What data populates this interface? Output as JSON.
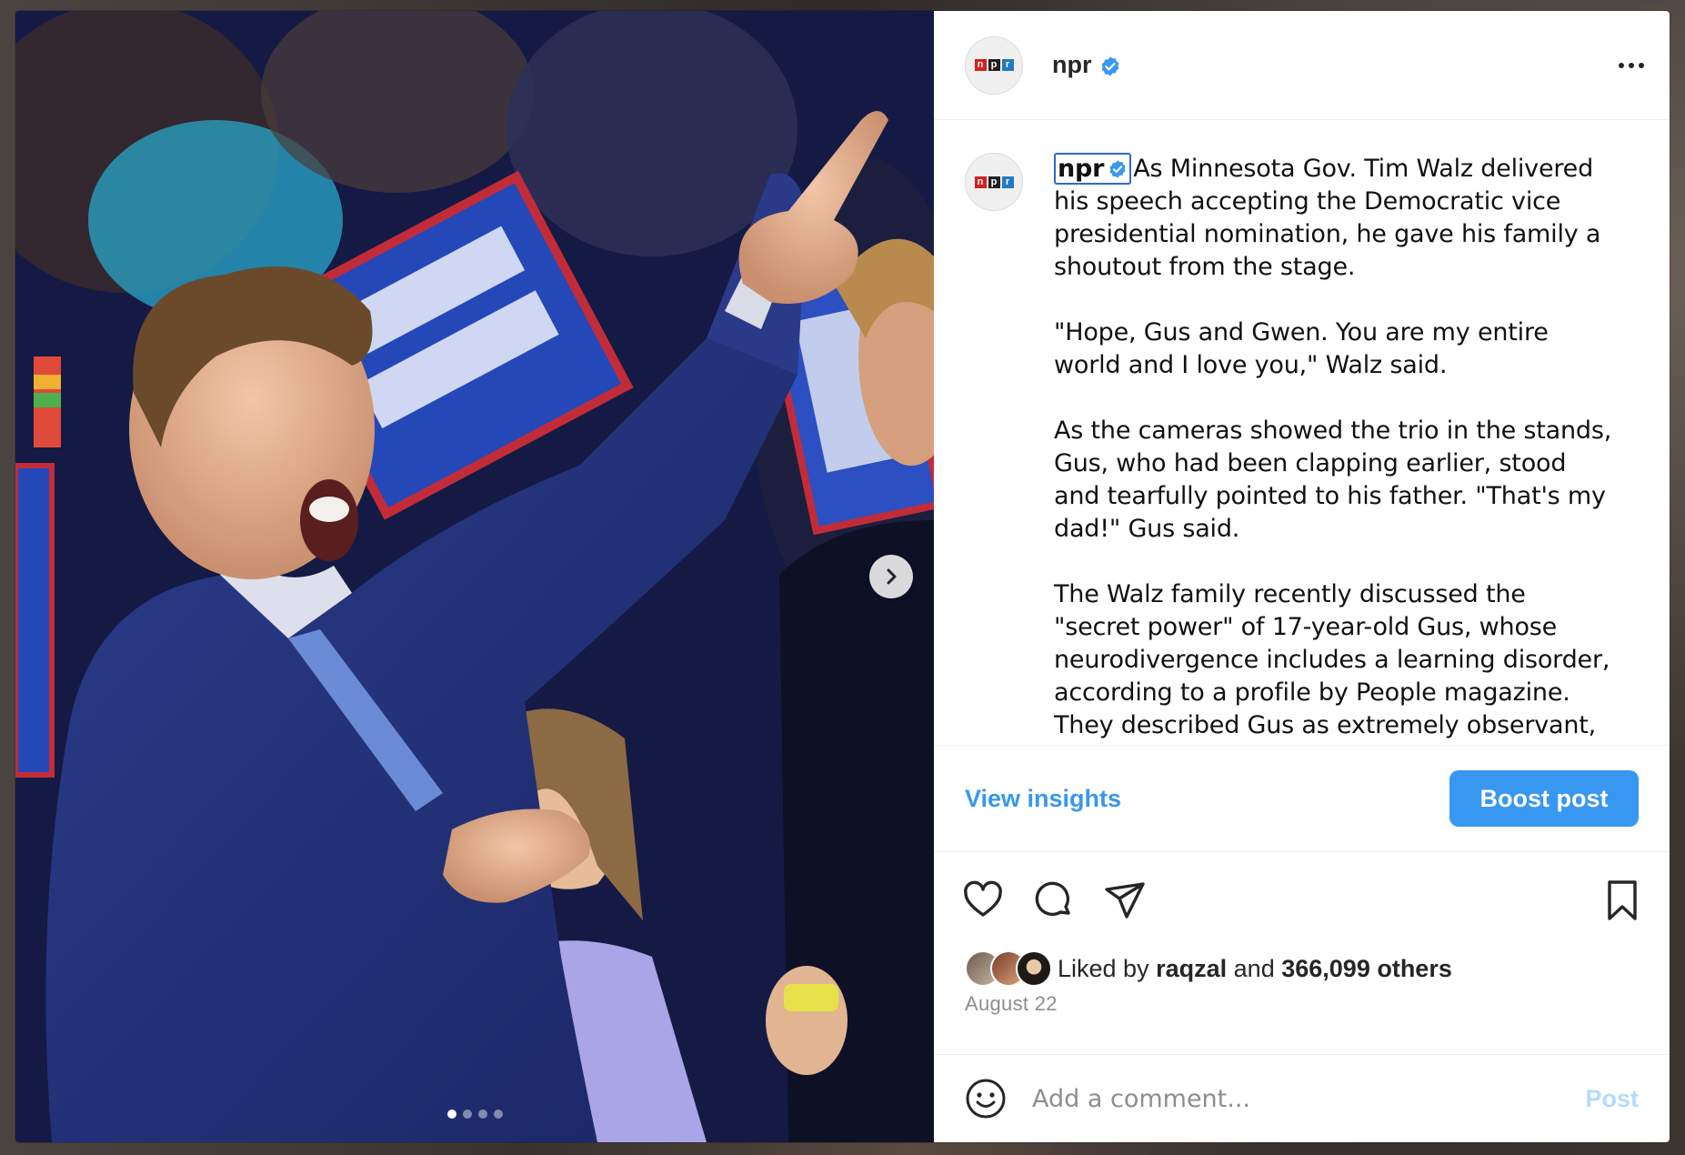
{
  "post": {
    "account": {
      "username": "npr",
      "verified": true,
      "avatar_logo": [
        "n",
        "p",
        "r"
      ]
    },
    "caption": {
      "username": "npr",
      "paragraphs": [
        "As Minnesota Gov. Tim Walz delivered his speech accepting the Democratic vice presidential nomination, he gave his family a shoutout from the stage.",
        "\"Hope, Gus and Gwen. You are my entire world and I love you,\" Walz said.",
        "As the cameras showed the trio in the stands, Gus, who had been clapping earlier, stood and tearfully pointed to his father. \"That's my dad!\" Gus said.",
        "The Walz family recently discussed the \"secret power\" of 17-year-old Gus, whose neurodivergence includes a learning disorder, according to a profile by People magazine. They described Gus as extremely observant,"
      ]
    },
    "actions": {
      "insights_label": "View insights",
      "boost_label": "Boost post"
    },
    "icons": {
      "like": "heart-icon",
      "comment": "comment-icon",
      "share": "share-icon",
      "save": "bookmark-icon",
      "emoji": "emoji-icon",
      "more": "more-options-icon",
      "next": "chevron-right-icon",
      "verified": "verified-badge-icon"
    },
    "likes": {
      "prefix": "Liked by",
      "user": "raqzal",
      "joiner": "and",
      "count_text": "366,099 others"
    },
    "date": "August 22",
    "comment": {
      "placeholder": "Add a comment...",
      "post_label": "Post"
    },
    "carousel": {
      "total": 4,
      "current": 1
    },
    "colors": {
      "accent": "#3897f0",
      "post_disabled": "#b3dbff",
      "verified": "#3897f0",
      "focus_ring": "#2b6ad6"
    }
  }
}
